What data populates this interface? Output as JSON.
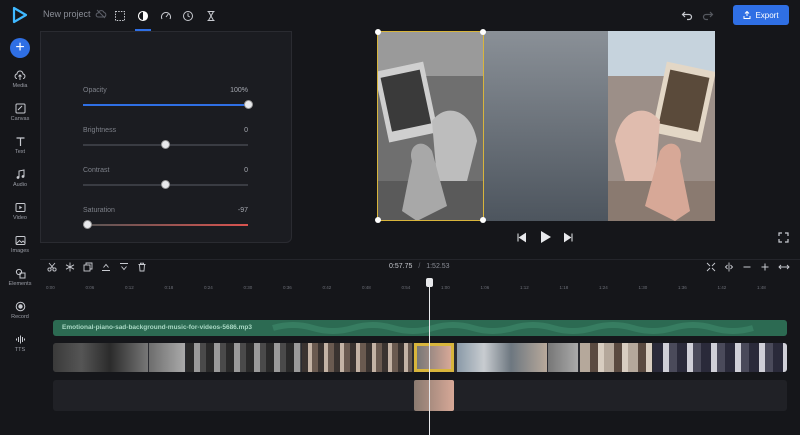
{
  "header": {
    "project_title": "New project",
    "export_label": "Export"
  },
  "sidebar": {
    "items": [
      {
        "label": "Media",
        "icon": "upload-cloud-icon"
      },
      {
        "label": "Canvas",
        "icon": "canvas-icon"
      },
      {
        "label": "Text",
        "icon": "text-icon"
      },
      {
        "label": "Audio",
        "icon": "music-note-icon"
      },
      {
        "label": "Video",
        "icon": "video-icon"
      },
      {
        "label": "Images",
        "icon": "image-icon"
      },
      {
        "label": "Elements",
        "icon": "shapes-icon"
      },
      {
        "label": "Record",
        "icon": "record-icon"
      },
      {
        "label": "TTS",
        "icon": "waveform-icon"
      }
    ]
  },
  "properties": {
    "tabs": [
      "crop-icon",
      "contrast-icon",
      "speed-icon",
      "clock-icon",
      "hourglass-icon"
    ],
    "active_tab": 1,
    "sliders": [
      {
        "label": "Opacity",
        "value": "100%",
        "fraction": 1.0,
        "color": "#2f6fe4"
      },
      {
        "label": "Brightness",
        "value": "0",
        "fraction": 0.5,
        "color": "#e8e9ec"
      },
      {
        "label": "Contrast",
        "value": "0",
        "fraction": 0.5,
        "color": "#e8e9ec"
      },
      {
        "label": "Saturation",
        "value": "-97",
        "fraction": 0.03,
        "color": "#d9534f"
      }
    ]
  },
  "timeline": {
    "current_time": "0:57.75",
    "separator": "/",
    "total_time": "1:52.53",
    "ruler_ticks": [
      "0:00",
      "0:06",
      "0:12",
      "0:18",
      "0:24",
      "0:30",
      "0:36",
      "0:42",
      "0:48",
      "0:54",
      "1:00",
      "1:06",
      "1:12",
      "1:18",
      "1:24",
      "1:30",
      "1:36",
      "1:42",
      "1:48"
    ],
    "audio_clip_name": "Emotional-piano-sad-background-music-for-videos-5686.mp3"
  },
  "colors": {
    "accent": "#2f6fe4",
    "audio_track": "#2c6a52",
    "selection": "#d8b53c"
  }
}
